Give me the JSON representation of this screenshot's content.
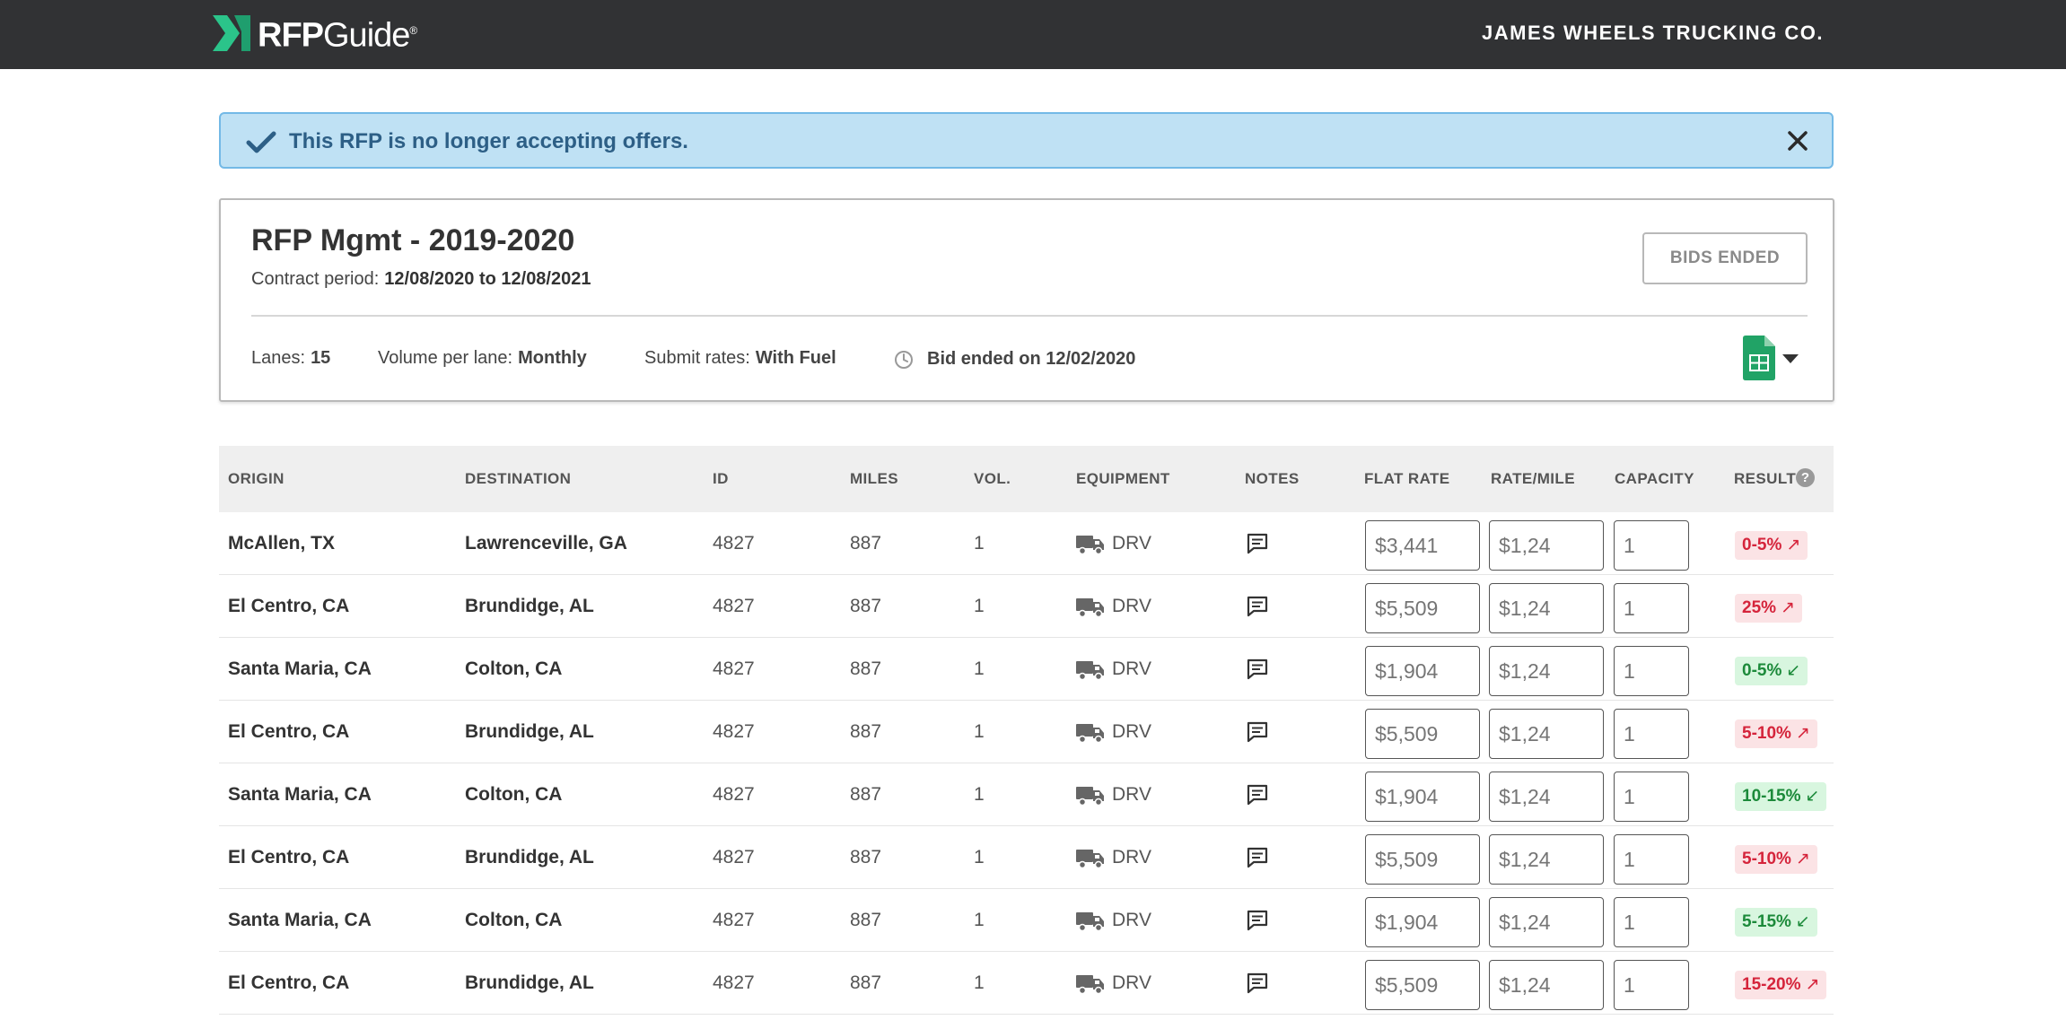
{
  "header": {
    "logo_text_bold": "RFP",
    "logo_text_light": "Guide",
    "logo_mark": "®",
    "company": "JAMES WHEELS TRUCKING CO."
  },
  "alert": {
    "message": "This RFP is no longer accepting offers.",
    "icon": "checkmark-icon",
    "close_icon": "close-icon"
  },
  "rfp": {
    "title": "RFP Mgmt - 2019-2020",
    "contract_label": "Contract period:",
    "contract_value": "12/08/2020 to 12/08/2021",
    "status_button": "BIDS ENDED",
    "lanes_label": "Lanes:",
    "lanes_value": "15",
    "volume_label": "Volume per lane:",
    "volume_value": "Monthly",
    "rates_label": "Submit rates:",
    "rates_value": "With Fuel",
    "bid_ended": "Bid ended on 12/02/2020"
  },
  "table": {
    "headers": {
      "origin": "ORIGIN",
      "destination": "DESTINATION",
      "id": "ID",
      "miles": "MILES",
      "vol": "VOL.",
      "equipment": "EQUIPMENT",
      "notes": "NOTES",
      "flat_rate": "FLAT RATE",
      "rate_mile": "RATE/MILE",
      "capacity": "CAPACITY",
      "result": "RESULT"
    },
    "help_icon_glyph": "?",
    "rows": [
      {
        "origin": "McAllen, TX",
        "destination": "Lawrenceville, GA",
        "id": "4827",
        "miles": "887",
        "vol": "1",
        "equipment": "DRV",
        "flat_rate": "$3,441",
        "rate_mile": "$1,24",
        "capacity": "1",
        "result": "0-5%",
        "result_arrow": "↗",
        "trend": "up"
      },
      {
        "origin": "El Centro, CA",
        "destination": "Brundidge, AL",
        "id": "4827",
        "miles": "887",
        "vol": "1",
        "equipment": "DRV",
        "flat_rate": "$5,509",
        "rate_mile": "$1,24",
        "capacity": "1",
        "result": "25%",
        "result_arrow": "↗",
        "trend": "up"
      },
      {
        "origin": "Santa Maria, CA",
        "destination": "Colton, CA",
        "id": "4827",
        "miles": "887",
        "vol": "1",
        "equipment": "DRV",
        "flat_rate": "$1,904",
        "rate_mile": "$1,24",
        "capacity": "1",
        "result": "0-5%",
        "result_arrow": "↙",
        "trend": "down"
      },
      {
        "origin": "El Centro, CA",
        "destination": "Brundidge, AL",
        "id": "4827",
        "miles": "887",
        "vol": "1",
        "equipment": "DRV",
        "flat_rate": "$5,509",
        "rate_mile": "$1,24",
        "capacity": "1",
        "result": "5-10%",
        "result_arrow": "↗",
        "trend": "up"
      },
      {
        "origin": "Santa Maria, CA",
        "destination": "Colton, CA",
        "id": "4827",
        "miles": "887",
        "vol": "1",
        "equipment": "DRV",
        "flat_rate": "$1,904",
        "rate_mile": "$1,24",
        "capacity": "1",
        "result": "10-15%",
        "result_arrow": "↙",
        "trend": "down"
      },
      {
        "origin": "El Centro, CA",
        "destination": "Brundidge, AL",
        "id": "4827",
        "miles": "887",
        "vol": "1",
        "equipment": "DRV",
        "flat_rate": "$5,509",
        "rate_mile": "$1,24",
        "capacity": "1",
        "result": "5-10%",
        "result_arrow": "↗",
        "trend": "up"
      },
      {
        "origin": "Santa Maria, CA",
        "destination": "Colton, CA",
        "id": "4827",
        "miles": "887",
        "vol": "1",
        "equipment": "DRV",
        "flat_rate": "$1,904",
        "rate_mile": "$1,24",
        "capacity": "1",
        "result": "5-15%",
        "result_arrow": "↙",
        "trend": "down"
      },
      {
        "origin": "El Centro, CA",
        "destination": "Brundidge, AL",
        "id": "4827",
        "miles": "887",
        "vol": "1",
        "equipment": "DRV",
        "flat_rate": "$5,509",
        "rate_mile": "$1,24",
        "capacity": "1",
        "result": "15-20%",
        "result_arrow": "↗",
        "trend": "up"
      }
    ]
  },
  "colors": {
    "topbar": "#313234",
    "alert_bg": "#bfe1f4",
    "alert_text": "#2d5f86",
    "brand_green": "#2bc48a",
    "sheet_green": "#21a366",
    "up_badge_bg": "#fbe3e5",
    "up_badge_text": "#d5243b",
    "down_badge_bg": "#d8f6df",
    "down_badge_text": "#1c8a3a"
  }
}
